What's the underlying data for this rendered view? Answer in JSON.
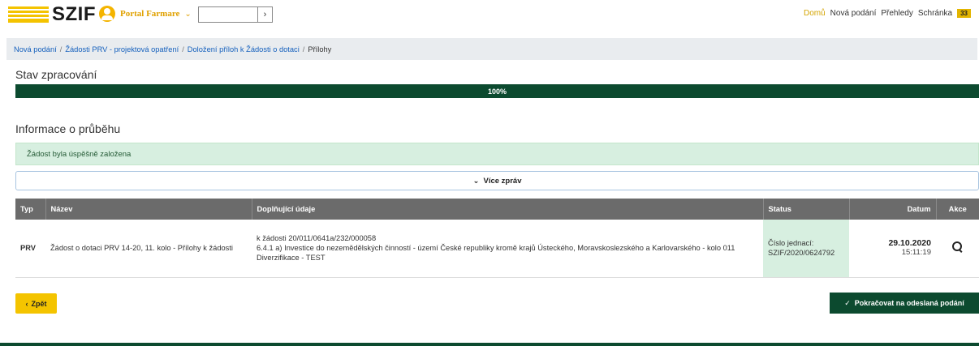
{
  "header": {
    "logo_text": "SZIF",
    "portal_label": "Portal Farmare",
    "nav": [
      {
        "label": "Domů"
      },
      {
        "label": "Nová podání"
      },
      {
        "label": "Přehledy"
      },
      {
        "label": "Schránka"
      }
    ],
    "inbox_count": "33"
  },
  "breadcrumb": {
    "items": [
      "Nová podání",
      "Žádosti PRV - projektová opatření",
      "Doložení příloh k Žádosti o dotaci"
    ],
    "current": "Přílohy"
  },
  "stav": {
    "title": "Stav zpracování",
    "progress_label": "100%",
    "progress_value": 100
  },
  "info": {
    "title": "Informace o průběhu",
    "alert": "Žádost byla úspěšně založena",
    "more_label": "Více zpráv"
  },
  "table": {
    "columns": [
      "Typ",
      "Název",
      "Doplňující údaje",
      "Status",
      "Datum",
      "Akce"
    ],
    "rows": [
      {
        "typ": "PRV",
        "nazev": "Žádost o dotaci PRV 14-20, 11. kolo - Přílohy k žádosti",
        "doplnujici": [
          "k žádosti 20/011/0641a/232/000058",
          "6.4.1 a) Investice do nezemědělských činností - území České republiky kromě krajů Ústeckého, Moravskoslezského a Karlovarského - kolo 011",
          "Diverzifikace - TEST"
        ],
        "status_label": "Číslo jednací:",
        "status_value": "SZIF/2020/0624792",
        "date": "29.10.2020",
        "time": "15:11:19"
      }
    ]
  },
  "actions": {
    "back_label": "Zpět",
    "continue_label": "Pokračovat na odeslaná podání"
  },
  "colors": {
    "brand_green": "#0c4a2f",
    "brand_yellow": "#f4c400",
    "link_blue": "#1560bd",
    "success_bg": "#d7efe0"
  }
}
